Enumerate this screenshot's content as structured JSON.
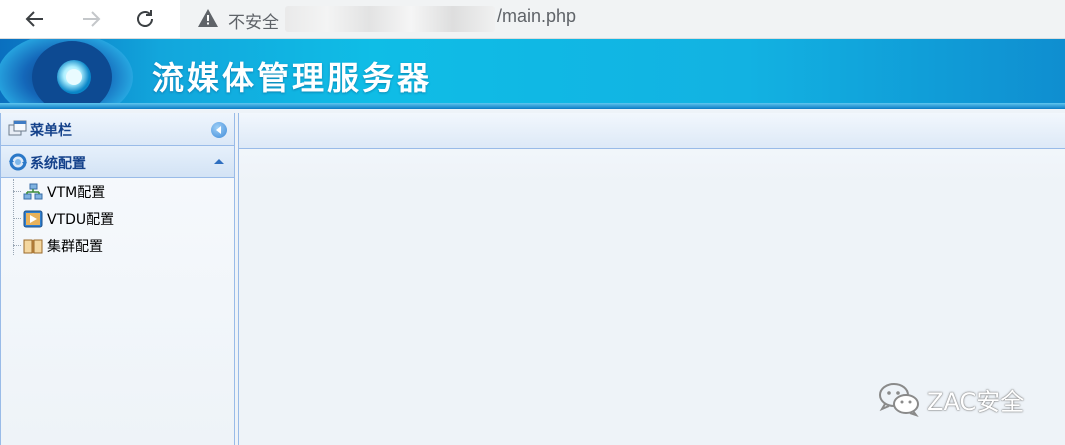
{
  "browser": {
    "security_label": "不安全",
    "url_path": "/main.php",
    "back_icon": "arrow-left-icon",
    "forward_icon": "arrow-right-icon",
    "reload_icon": "reload-icon",
    "warning_icon": "warning-triangle-icon"
  },
  "banner": {
    "title": "流媒体管理服务器"
  },
  "sidebar": {
    "header_label": "菜单栏",
    "section_label": "系统配置",
    "items": [
      {
        "label": "VTM配置",
        "icon": "network-icon"
      },
      {
        "label": "VTDU配置",
        "icon": "video-icon"
      },
      {
        "label": "集群配置",
        "icon": "book-icon"
      }
    ]
  },
  "watermark": {
    "text": "ZAC安全"
  },
  "colors": {
    "banner_blue": "#12b2e2",
    "panel_border": "#99bbe8",
    "panel_text": "#15428b"
  }
}
